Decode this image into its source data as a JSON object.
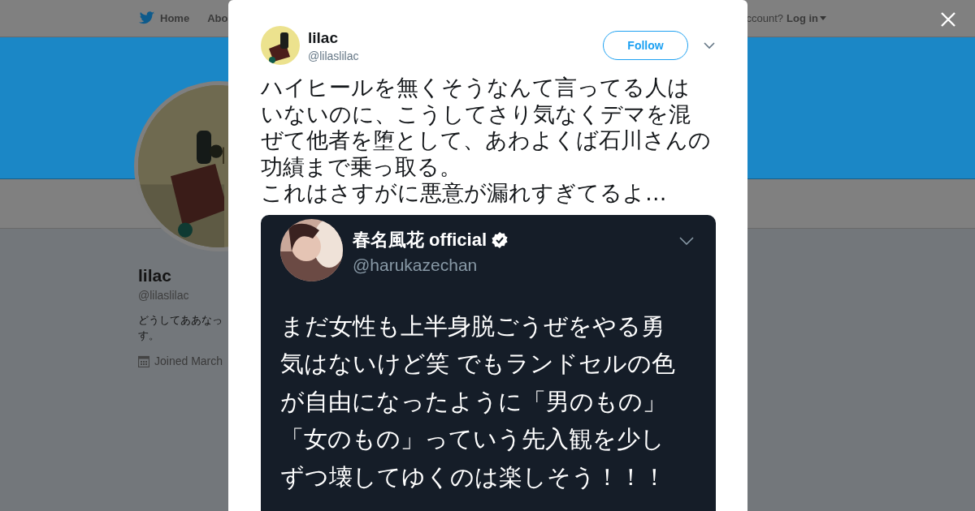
{
  "nav": {
    "items": [
      {
        "label": "Home"
      },
      {
        "label": "Abo"
      }
    ],
    "account_prompt": "ccount?",
    "login": "Log in"
  },
  "profile": {
    "name": "lilac",
    "handle": "@lilaslilac",
    "bio_lines": [
      "どうしてああなっ",
      "す。"
    ],
    "joined": "Joined March"
  },
  "tweet": {
    "author": "lilac",
    "handle": "@lilaslilac",
    "follow_label": "Follow",
    "text_lines": [
      "ハイヒールを無くそうなんて言ってる人は",
      "いないのに、こうしてさり気なくデマを混",
      "ぜて他者を堕として、あわよくば石川さんの",
      "功績まで乗っ取る。",
      "これはさすがに悪意が漏れすぎてるよ…"
    ],
    "media": {
      "kind": "screenshot",
      "author": "春名風花 official",
      "verified": true,
      "handle": "@harukazechan",
      "text_lines": [
        "まだ女性も上半身脱ごうぜをやる勇",
        "気はないけど笑 でもランドセルの色",
        "が自由になったように「男のもの」",
        "「女のもの」っていう先入観を少し",
        "ずつ壊してゆくのは楽しそう！！！"
      ]
    }
  }
}
